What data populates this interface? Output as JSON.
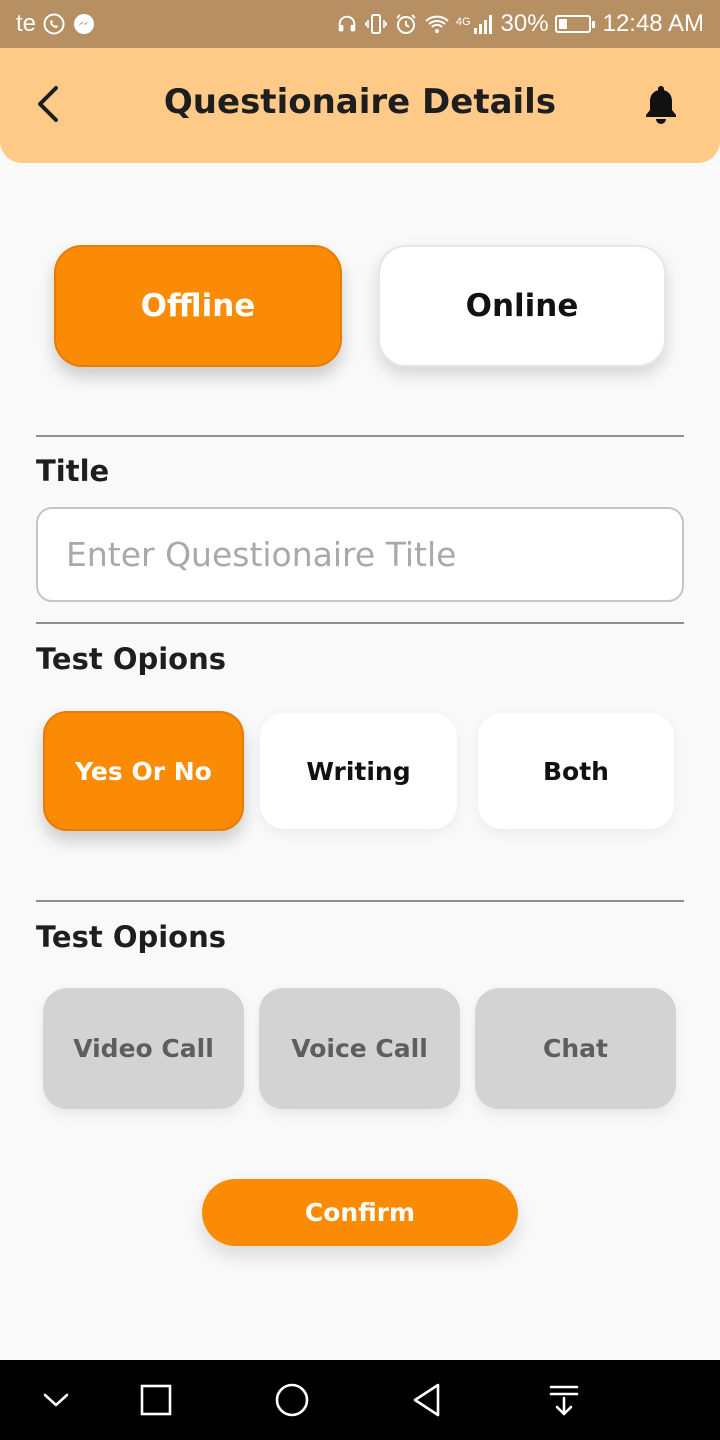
{
  "status_bar": {
    "left_text": "te",
    "network": "4G",
    "battery": "30%",
    "battery_level": 0.3,
    "time": "12:48 AM"
  },
  "header": {
    "title": "Questionaire Details",
    "back_icon": "chevron-left-icon",
    "bell_icon": "bell-icon"
  },
  "mode": {
    "options": [
      "Offline",
      "Online"
    ],
    "selected": "Offline"
  },
  "title_section": {
    "label": "Title",
    "value": "",
    "placeholder": "Enter Questionaire Title"
  },
  "test_options": {
    "label": "Test Opions",
    "options": [
      "Yes Or No",
      "Writing",
      "Both"
    ],
    "selected": "Yes Or No"
  },
  "call_options": {
    "label": "Test Opions",
    "options": [
      "Video Call",
      "Voice Call",
      "Chat"
    ]
  },
  "confirm_label": "Confirm",
  "colors": {
    "accent": "#fb8a04",
    "header_bg": "#ffca88",
    "status_bar_bg": "#b69063",
    "disabled_bg": "#d3d3d3"
  }
}
